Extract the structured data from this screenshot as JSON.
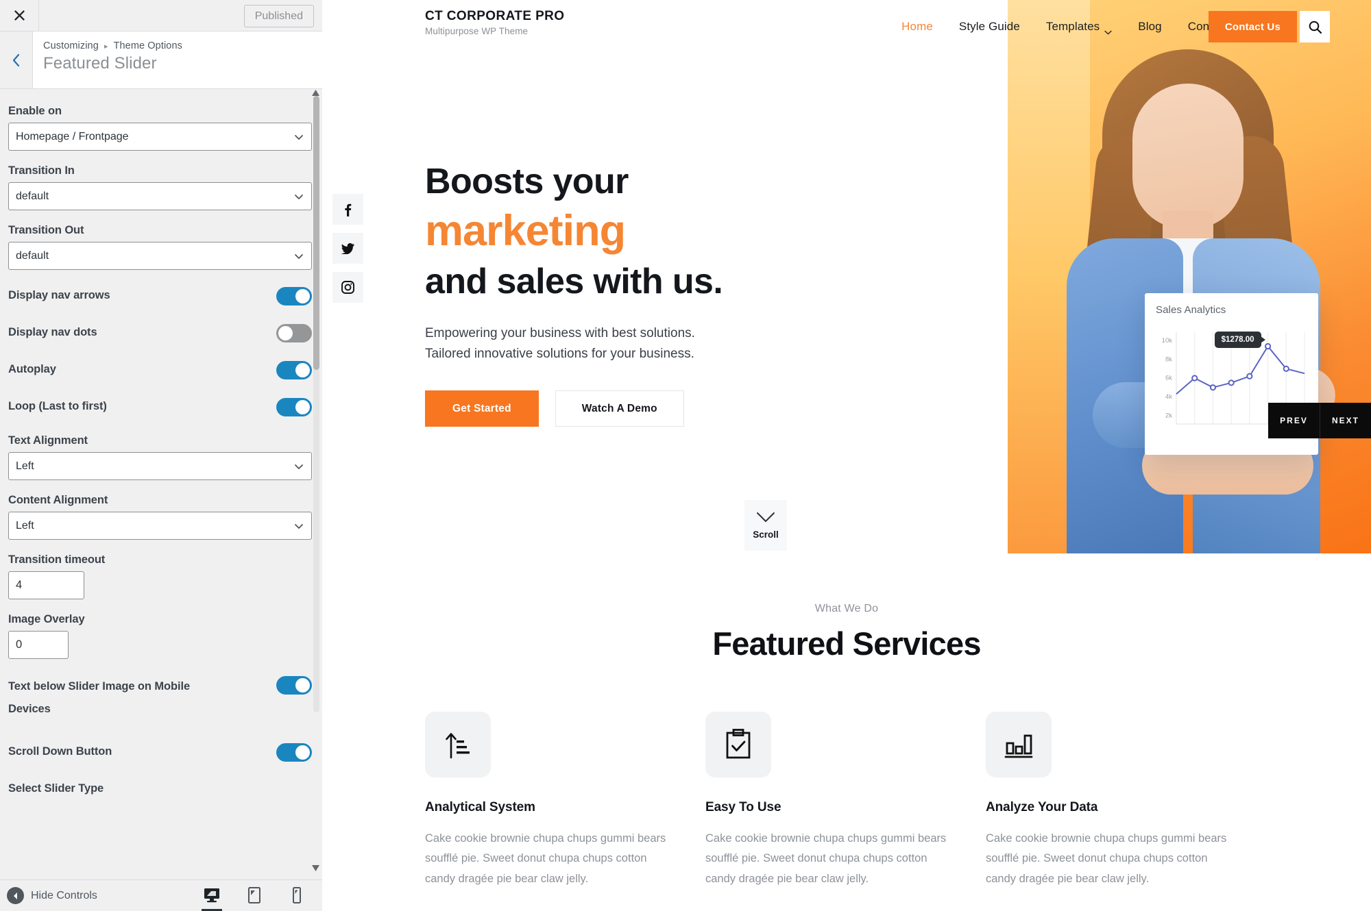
{
  "customizer": {
    "close_icon": "close-icon",
    "publish_label": "Published",
    "back_icon": "chevron-left-icon",
    "breadcrumb_root": "Customizing",
    "breadcrumb_sep": "▸",
    "breadcrumb_parent": "Theme Options",
    "panel_title": "Featured Slider",
    "fields": [
      {
        "type": "select",
        "name": "enable-on",
        "label": "Enable on",
        "value": "Homepage / Frontpage"
      },
      {
        "type": "select",
        "name": "transition-in",
        "label": "Transition In",
        "value": "default"
      },
      {
        "type": "select",
        "name": "transition-out",
        "label": "Transition Out",
        "value": "default"
      },
      {
        "type": "toggle",
        "name": "display-nav-arrows",
        "label": "Display nav arrows",
        "state": "on"
      },
      {
        "type": "toggle",
        "name": "display-nav-dots",
        "label": "Display nav dots",
        "state": "off"
      },
      {
        "type": "toggle",
        "name": "autoplay",
        "label": "Autoplay",
        "state": "on"
      },
      {
        "type": "toggle",
        "name": "loop",
        "label": "Loop (Last to first)",
        "state": "on"
      },
      {
        "type": "select",
        "name": "text-alignment",
        "label": "Text Alignment",
        "value": "Left"
      },
      {
        "type": "select",
        "name": "content-alignment",
        "label": "Content Alignment",
        "value": "Left"
      },
      {
        "type": "input",
        "name": "transition-timeout",
        "label": "Transition timeout",
        "value": "4"
      },
      {
        "type": "input",
        "name": "image-overlay",
        "label": "Image Overlay",
        "value": "0"
      },
      {
        "type": "toggle",
        "name": "text-below-slider",
        "label": "Text below Slider Image on Mobile Devices",
        "state": "on"
      },
      {
        "type": "toggle",
        "name": "scroll-down-button",
        "label": "Scroll Down Button",
        "state": "on"
      },
      {
        "type": "label",
        "name": "select-slider-type",
        "label": "Select Slider Type"
      }
    ],
    "footer": {
      "hide_controls_label": "Hide Controls",
      "devices": [
        {
          "name": "desktop-preview",
          "icon": "desktop-icon",
          "active": true
        },
        {
          "name": "tablet-preview",
          "icon": "tablet-icon",
          "active": false
        },
        {
          "name": "mobile-preview",
          "icon": "mobile-icon",
          "active": false
        }
      ]
    }
  },
  "site": {
    "brand": {
      "title": "CT CORPORATE PRO",
      "subtitle": "Multipurpose WP Theme"
    },
    "nav": [
      {
        "label": "Home",
        "active": true,
        "caret": false
      },
      {
        "label": "Style Guide",
        "active": false,
        "caret": false
      },
      {
        "label": "Templates",
        "active": false,
        "caret": true
      },
      {
        "label": "Blog",
        "active": false,
        "caret": false
      },
      {
        "label": "Contact",
        "active": false,
        "caret": false
      }
    ],
    "cta_label": "Contact Us",
    "search_icon": "search-icon",
    "socials": [
      {
        "name": "facebook-icon",
        "glyph": "f"
      },
      {
        "name": "twitter-icon",
        "glyph": "t"
      },
      {
        "name": "instagram-icon",
        "glyph": "i"
      }
    ],
    "hero": {
      "title_line1": "Boosts your",
      "title_accent": "marketing",
      "title_line3": "and sales with us.",
      "paragraph_line1": "Empowering your business with best solutions.",
      "paragraph_line2": "Tailored innovative solutions for your business.",
      "primary_btn": "Get Started",
      "secondary_btn": "Watch A Demo",
      "scroll_label": "Scroll",
      "prev_label": "PREV",
      "next_label": "NEXT"
    },
    "services": {
      "eyebrow": "What We Do",
      "title": "Featured Services",
      "items": [
        {
          "icon": "arrow-up-bars-icon",
          "title": "Analytical System",
          "desc": "Cake cookie brownie chupa chups gummi bears soufflé pie. Sweet donut chupa chups cotton candy dragée pie bear claw jelly."
        },
        {
          "icon": "clipboard-check-icon",
          "title": "Easy To Use",
          "desc": "Cake cookie brownie chupa chups gummi bears soufflé pie. Sweet donut chupa chups cotton candy dragée pie bear claw jelly."
        },
        {
          "icon": "bar-chart-icon",
          "title": "Analyze Your Data",
          "desc": "Cake cookie brownie chupa chups gummi bears soufflé pie. Sweet donut chupa chups cotton candy dragée pie bear claw jelly."
        }
      ]
    },
    "colors": {
      "accent": "#f58634",
      "cta": "#f7761f",
      "chart_line": "#5b63c4",
      "toggle_on": "#1a86c0",
      "toggle_off": "#949698"
    }
  },
  "chart_data": {
    "type": "line",
    "title": "Sales Analytics",
    "xlabel": "",
    "ylabel": "",
    "ylim": [
      1000,
      10800
    ],
    "yticks": [
      2000,
      4000,
      6000,
      8000,
      10000
    ],
    "ytick_labels": [
      "2k",
      "4k",
      "6k",
      "8k",
      "10k"
    ],
    "grid": "vertical",
    "x": [
      0,
      1,
      2,
      3,
      4,
      5,
      6,
      7
    ],
    "values": [
      4200,
      5900,
      4900,
      5400,
      6100,
      9300,
      6900,
      6400
    ],
    "annotation": {
      "text": "$1278.00",
      "point_index": 5
    },
    "legend": "none"
  }
}
